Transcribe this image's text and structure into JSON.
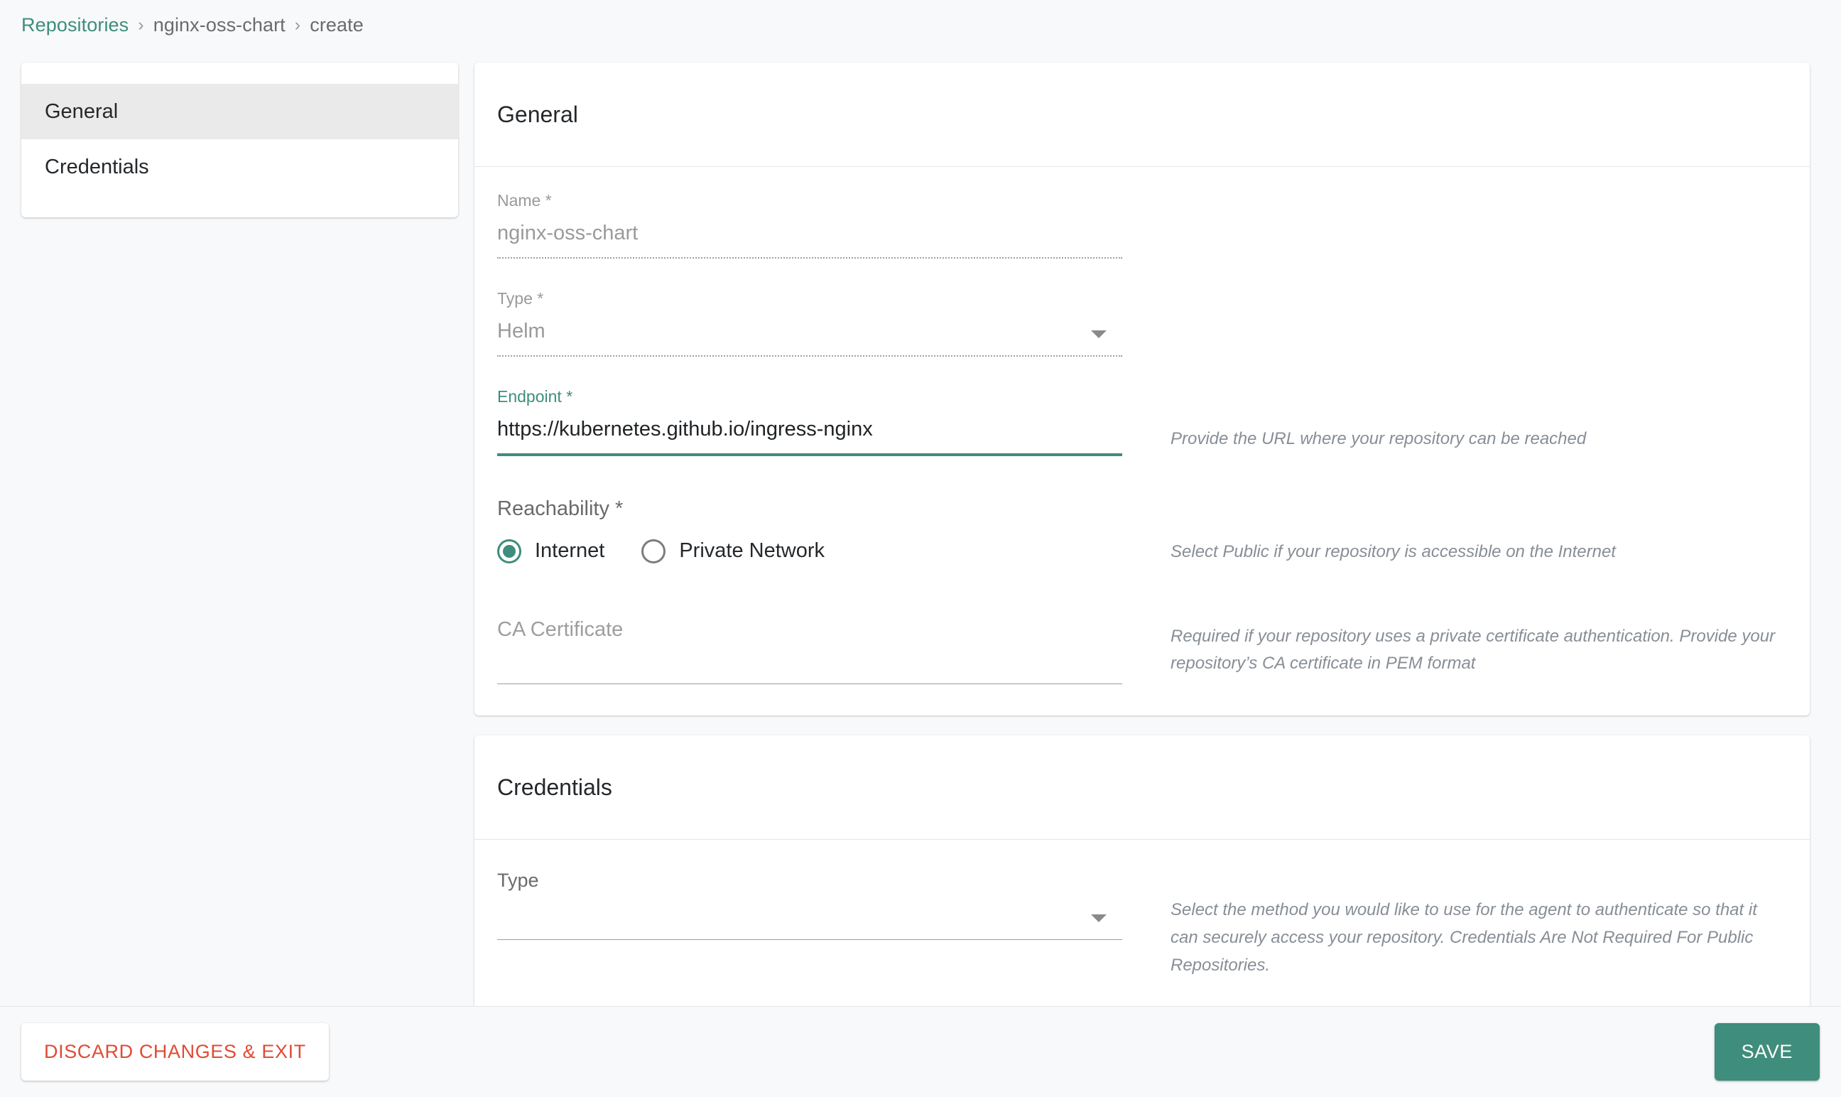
{
  "colors": {
    "accent": "#3f8d7c",
    "danger": "#e04b35",
    "page_bg": "#f7f9fa",
    "nav_active_bg": "#eaeaea",
    "hint_text": "#878e96"
  },
  "breadcrumb": {
    "root": "Repositories",
    "separator": "›",
    "repo": "nginx-oss-chart",
    "action": "create"
  },
  "sidebar": {
    "items": [
      {
        "label": "General",
        "active": true
      },
      {
        "label": "Credentials",
        "active": false
      }
    ]
  },
  "general_section": {
    "title": "General",
    "name_field": {
      "label": "Name *",
      "value": "nginx-oss-chart",
      "placeholder": ""
    },
    "type_field": {
      "label": "Type *",
      "value": "Helm",
      "placeholder": "",
      "options": [
        "Helm"
      ]
    },
    "endpoint_field": {
      "label": "Endpoint *",
      "value": "https://kubernetes.github.io/ingress-nginx",
      "placeholder": "",
      "hint": "Provide the URL where your repository can be reached"
    },
    "reachability_field": {
      "label": "Reachability *",
      "options": [
        {
          "label": "Internet",
          "selected": true
        },
        {
          "label": "Private Network",
          "selected": false
        }
      ],
      "hint": "Select Public if your repository is accessible on the Internet"
    },
    "ca_certificate_field": {
      "label": "CA Certificate",
      "value": "",
      "placeholder": "CA Certificate",
      "hint": "Required if your repository uses a private certificate authentication. Provide your repository’s CA certificate in PEM format"
    }
  },
  "credentials_section": {
    "title": "Credentials",
    "type_field": {
      "label": "Type",
      "value": "",
      "placeholder": "",
      "hint": "Select the method you would like to use for the agent to authenticate so that it can securely access your repository. Credentials Are Not Required For Public Repositories."
    }
  },
  "actions": {
    "discard_label": "DISCARD CHANGES & EXIT",
    "save_label": "SAVE"
  }
}
